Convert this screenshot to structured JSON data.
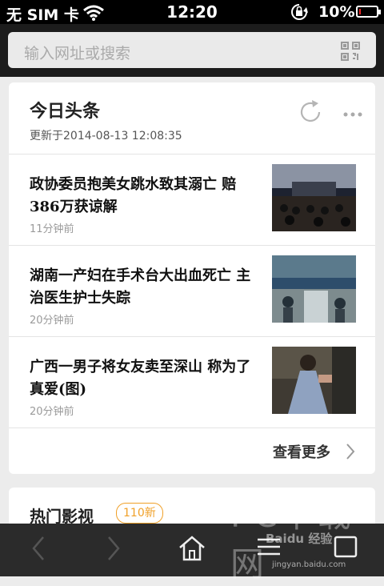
{
  "status": {
    "carrier": "无 SIM 卡",
    "time": "12:20",
    "battery": "10%",
    "battery_level": 0.1
  },
  "urlbar": {
    "placeholder": "输入网址或搜索"
  },
  "headlines": {
    "title": "今日头条",
    "updated": "更新于2014-08-13 12:08:35",
    "items": [
      {
        "title": "政协委员抱美女跳水致其溺亡 赔386万获谅解",
        "time": "11分钟前"
      },
      {
        "title": "湖南一产妇在手术台大出血死亡 主治医生护士失踪",
        "time": "20分钟前"
      },
      {
        "title": "广西一男子将女友卖至深山 称为了真爱(图)",
        "time": "20分钟前"
      }
    ],
    "see_more": "查看更多"
  },
  "hot_video": {
    "title": "热门影视",
    "badge": "110新"
  },
  "watermark": {
    "main": "PC下载网",
    "brand": "Baidu 经验",
    "url": "jingyan.baidu.com"
  },
  "icons": [
    "wifi-icon",
    "lock-rotation-icon",
    "battery-icon",
    "qr-code-icon",
    "refresh-icon",
    "more-dots-icon",
    "chevron-right-icon",
    "back-icon",
    "forward-icon",
    "home-icon",
    "menu-icon",
    "tabs-icon"
  ],
  "colors": {
    "accent": "#f0a028",
    "toolbar": "#2b2b2b"
  }
}
